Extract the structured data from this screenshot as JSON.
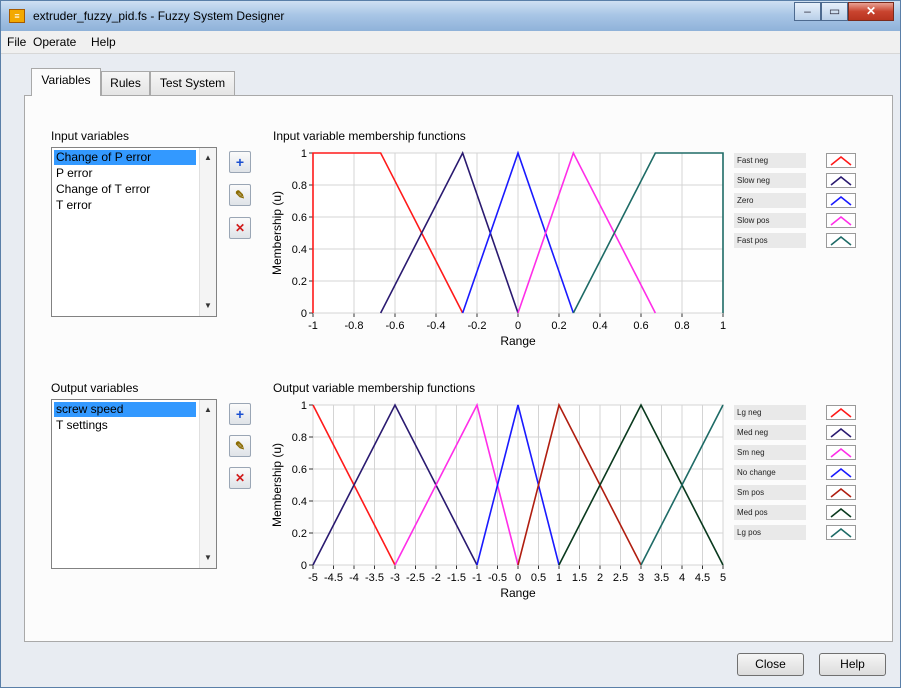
{
  "window": {
    "title": "extruder_fuzzy_pid.fs - Fuzzy System Designer",
    "icon": "labview-app-icon"
  },
  "window_controls": {
    "minimize": "–",
    "maximize": "▭",
    "close": "✕"
  },
  "menu": [
    "File",
    "Operate",
    "Help"
  ],
  "tabs": [
    "Variables",
    "Rules",
    "Test System"
  ],
  "input": {
    "label": "Input variables",
    "items": [
      "Change of P error",
      "P error",
      "Change of T error",
      "T error"
    ],
    "selected": 0,
    "chart_title": "Input variable membership functions"
  },
  "output": {
    "label": "Output variables",
    "items": [
      "screw speed",
      "T settings"
    ],
    "selected": 0,
    "chart_title": "Output variable membership functions"
  },
  "tools": {
    "add": "+",
    "edit": "✎",
    "delete": "✕"
  },
  "buttons": {
    "close": "Close",
    "help": "Help"
  },
  "colors": {
    "red": "#ff1a1a",
    "navy": "#2a1a70",
    "blue": "#1a1aff",
    "magenta": "#ff2ee8",
    "teal": "#1e6b66",
    "brown": "#b01e10",
    "darkgreen": "#0a3a1e",
    "selection": "#3399ff"
  },
  "chart_data": [
    {
      "type": "line",
      "title": "Input variable membership functions",
      "xlabel": "Range",
      "ylabel": "Membership (u)",
      "xlim": [
        -1,
        1
      ],
      "ylim": [
        0,
        1
      ],
      "xticks": [
        -1,
        -0.8,
        -0.6,
        -0.4,
        -0.2,
        0,
        0.2,
        0.4,
        0.6,
        0.8,
        1
      ],
      "xtick_labels": [
        "-1",
        "-0.8",
        "-0.6",
        "-0.4",
        "-0.2",
        "0",
        "0.2",
        "0.4",
        "0.6",
        "0.8",
        "1"
      ],
      "yticks": [
        0,
        0.2,
        0.4,
        0.6,
        0.8,
        1
      ],
      "ytick_labels": [
        "0",
        "0.2",
        "0.4",
        "0.6",
        "0.8",
        "1"
      ],
      "grid": true,
      "series": [
        {
          "name": "Fast neg",
          "color": "#ff1a1a",
          "x": [
            -1,
            -1,
            -0.67,
            -0.27
          ],
          "y": [
            0,
            1,
            1,
            0
          ]
        },
        {
          "name": "Slow neg",
          "color": "#2a1a70",
          "x": [
            -0.67,
            -0.27,
            0
          ],
          "y": [
            0,
            1,
            0
          ]
        },
        {
          "name": "Zero",
          "color": "#1a1aff",
          "x": [
            -0.27,
            0,
            0.27
          ],
          "y": [
            0,
            1,
            0
          ]
        },
        {
          "name": "Slow pos",
          "color": "#ff2ee8",
          "x": [
            0,
            0.27,
            0.67
          ],
          "y": [
            0,
            1,
            0
          ]
        },
        {
          "name": "Fast pos",
          "color": "#1e6b66",
          "x": [
            0.27,
            0.67,
            1,
            1
          ],
          "y": [
            0,
            1,
            1,
            0
          ]
        }
      ]
    },
    {
      "type": "line",
      "title": "Output variable membership functions",
      "xlabel": "Range",
      "ylabel": "Membership (u)",
      "xlim": [
        -5,
        5
      ],
      "ylim": [
        0,
        1
      ],
      "xticks": [
        -5,
        -4.5,
        -4,
        -3.5,
        -3,
        -2.5,
        -2,
        -1.5,
        -1,
        -0.5,
        0,
        0.5,
        1,
        1.5,
        2,
        2.5,
        3,
        3.5,
        4,
        4.5,
        5
      ],
      "xtick_labels": [
        "-5",
        "-4.5",
        "-4",
        "-3.5",
        "-3",
        "-2.5",
        "-2",
        "-1.5",
        "-1",
        "-0.5",
        "0",
        "0.5",
        "1",
        "1.5",
        "2",
        "2.5",
        "3",
        "3.5",
        "4",
        "4.5",
        "5"
      ],
      "yticks": [
        0,
        0.2,
        0.4,
        0.6,
        0.8,
        1
      ],
      "ytick_labels": [
        "0",
        "0.2",
        "0.4",
        "0.6",
        "0.8",
        "1"
      ],
      "grid": true,
      "series": [
        {
          "name": "Lg neg",
          "color": "#ff1a1a",
          "x": [
            -5,
            -3
          ],
          "y": [
            1,
            0
          ]
        },
        {
          "name": "Med neg",
          "color": "#2a1a70",
          "x": [
            -5,
            -3,
            -1
          ],
          "y": [
            0,
            1,
            0
          ]
        },
        {
          "name": "Sm neg",
          "color": "#ff2ee8",
          "x": [
            -3,
            -1,
            0
          ],
          "y": [
            0,
            1,
            0
          ]
        },
        {
          "name": "No change",
          "color": "#1a1aff",
          "x": [
            -1,
            0,
            1
          ],
          "y": [
            0,
            1,
            0
          ]
        },
        {
          "name": "Sm pos",
          "color": "#b01e10",
          "x": [
            0,
            1,
            3
          ],
          "y": [
            0,
            1,
            0
          ]
        },
        {
          "name": "Med pos",
          "color": "#0a3a1e",
          "x": [
            1,
            3,
            5
          ],
          "y": [
            0,
            1,
            0
          ]
        },
        {
          "name": "Lg pos",
          "color": "#1e6b66",
          "x": [
            3,
            5
          ],
          "y": [
            0,
            1
          ]
        }
      ]
    }
  ]
}
